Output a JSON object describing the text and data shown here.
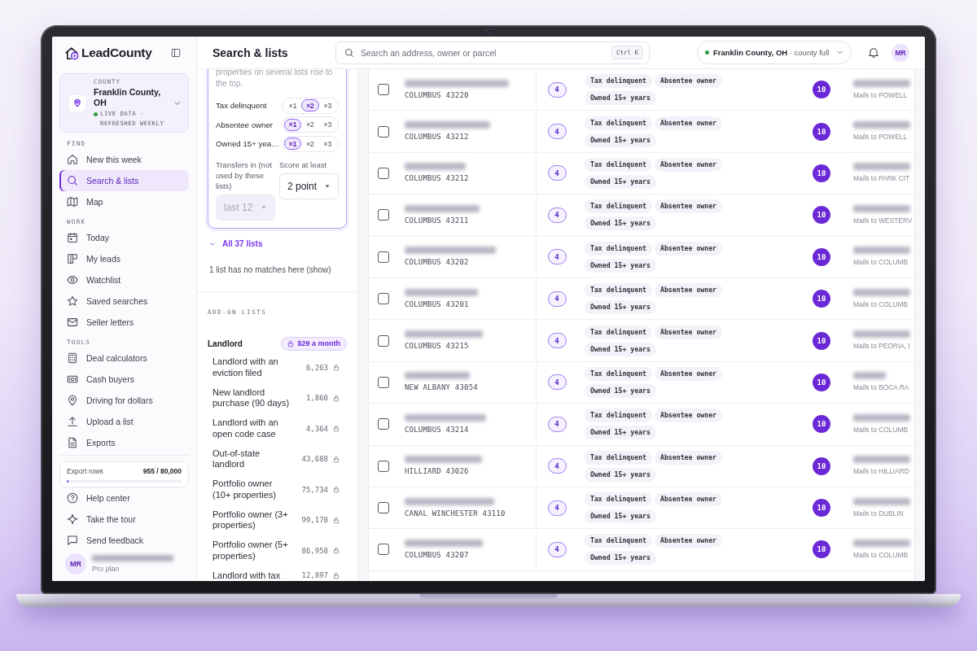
{
  "sidebar": {
    "brand": "LeadCounty",
    "county": {
      "label": "COUNTY",
      "name": "Franklin County, OH",
      "status": "LIVE DATA · REFRESHED WEEKLY"
    },
    "sections": [
      {
        "heading": "FIND",
        "items": [
          {
            "label": "New this week",
            "selected": false
          },
          {
            "label": "Search & lists",
            "selected": true
          },
          {
            "label": "Map",
            "selected": false
          }
        ]
      },
      {
        "heading": "WORK",
        "items": [
          {
            "label": "Today",
            "selected": false
          },
          {
            "label": "My leads",
            "selected": false
          },
          {
            "label": "Watchlist",
            "selected": false
          },
          {
            "label": "Saved searches",
            "selected": false
          },
          {
            "label": "Seller letters",
            "selected": false
          }
        ]
      },
      {
        "heading": "TOOLS",
        "items": [
          {
            "label": "Deal calculators",
            "selected": false
          },
          {
            "label": "Cash buyers",
            "selected": false
          },
          {
            "label": "Driving for dollars",
            "selected": false
          },
          {
            "label": "Upload a list",
            "selected": false
          },
          {
            "label": "Exports",
            "selected": false
          }
        ]
      }
    ],
    "export_meter": {
      "label": "Export rows",
      "reading": "955 / 80,000",
      "level": 0.012
    },
    "footer_links": [
      "Help center",
      "Take the tour",
      "Send feedback"
    ],
    "user": {
      "initials": "MR",
      "plan": "Pro plan"
    }
  },
  "topbar": {
    "title": "Search & lists",
    "search": {
      "placeholder": "Search an address, owner or parcel",
      "shortcut": "Ctrl K"
    },
    "county_pill": "**Franklin County, OH** · county full",
    "avatar": "MR"
  },
  "filters": {
    "description": "properties on several lists rise to the top.",
    "weights": [
      {
        "list": "Tax delinquent",
        "options": [
          {
            "label": "×1",
            "selected": false
          },
          {
            "label": "×2",
            "selected": true
          },
          {
            "label": "×3",
            "selected": false
          }
        ]
      },
      {
        "list": "Absentee owner",
        "options": [
          {
            "label": "×1",
            "selected": true
          },
          {
            "label": "×2",
            "selected": false
          },
          {
            "label": "×3",
            "selected": false
          }
        ]
      },
      {
        "list": "Owned 15+ yea…",
        "options": [
          {
            "label": "×1",
            "selected": true
          },
          {
            "label": "×2",
            "selected": false
          },
          {
            "label": "×3",
            "selected": false
          }
        ]
      }
    ],
    "transfers": {
      "label": "Transfers in (not used by these lists)",
      "value": "last 12",
      "disabled": true
    },
    "score": {
      "label": "Score at least",
      "value": "2 point"
    },
    "all_lists_link": "All 37 lists",
    "no_match_note": "1 list has no matches here (show)"
  },
  "add_on_lists": {
    "heading": "ADD-ON LISTS",
    "groups": [
      {
        "name": "Landlord",
        "price": "$29 a month",
        "items": [
          {
            "label": "Landlord with an eviction filed",
            "count": "6,263",
            "locked": true
          },
          {
            "label": "New landlord purchase (90 days)",
            "count": "1,860",
            "locked": true
          },
          {
            "label": "Landlord with an open code case",
            "count": "4,364",
            "locked": true
          },
          {
            "label": "Out-of-state landlord",
            "count": "43,688",
            "locked": true
          },
          {
            "label": "Portfolio owner (10+ properties)",
            "count": "75,734",
            "locked": true
          },
          {
            "label": "Portfolio owner (3+ properties)",
            "count": "99,170",
            "locked": true
          },
          {
            "label": "Portfolio owner (5+ properties)",
            "count": "86,958",
            "locked": true
          },
          {
            "label": "Landlord with tax",
            "count": "12,897",
            "locked": true
          }
        ]
      }
    ]
  },
  "table": {
    "rows": [
      {
        "checked": false,
        "city": "COLUMBUS 43220",
        "lists": "4",
        "tags": [
          "Tax delinquent",
          "Absentee owner",
          "Owned 15+ years"
        ],
        "score": "10",
        "mailing": "Mails to POWELL"
      },
      {
        "checked": false,
        "city": "COLUMBUS 43212",
        "lists": "4",
        "tags": [
          "Tax delinquent",
          "Absentee owner",
          "Owned 15+ years"
        ],
        "score": "10",
        "mailing": "Mails to POWELL"
      },
      {
        "checked": false,
        "city": "COLUMBUS 43212",
        "lists": "4",
        "tags": [
          "Tax delinquent",
          "Absentee owner",
          "Owned 15+ years"
        ],
        "score": "10",
        "mailing": "Mails to PARK CIT"
      },
      {
        "checked": false,
        "city": "COLUMBUS 43211",
        "lists": "4",
        "tags": [
          "Tax delinquent",
          "Absentee owner",
          "Owned 15+ years"
        ],
        "score": "10",
        "mailing": "Mails to WESTERV"
      },
      {
        "checked": false,
        "city": "COLUMBUS 43202",
        "lists": "4",
        "tags": [
          "Tax delinquent",
          "Absentee owner",
          "Owned 15+ years"
        ],
        "score": "10",
        "mailing": "Mails to COLUMB"
      },
      {
        "checked": false,
        "city": "COLUMBUS 43201",
        "lists": "4",
        "tags": [
          "Tax delinquent",
          "Absentee owner",
          "Owned 15+ years"
        ],
        "score": "10",
        "mailing": "Mails to COLUMB"
      },
      {
        "checked": false,
        "city": "COLUMBUS 43215",
        "lists": "4",
        "tags": [
          "Tax delinquent",
          "Absentee owner",
          "Owned 15+ years"
        ],
        "score": "10",
        "mailing": "Mails to PEORIA, I"
      },
      {
        "checked": false,
        "city": "NEW ALBANY 43054",
        "lists": "4",
        "tags": [
          "Tax delinquent",
          "Absentee owner",
          "Owned 15+ years"
        ],
        "score": "10",
        "mailing": "Mails to BOCA RA"
      },
      {
        "checked": false,
        "city": "COLUMBUS 43214",
        "lists": "4",
        "tags": [
          "Tax delinquent",
          "Absentee owner",
          "Owned 15+ years"
        ],
        "score": "10",
        "mailing": "Mails to COLUMB"
      },
      {
        "checked": false,
        "city": "HILLIARD 43026",
        "lists": "4",
        "tags": [
          "Tax delinquent",
          "Absentee owner",
          "Owned 15+ years"
        ],
        "score": "10",
        "mailing": "Mails to HILLIARD"
      },
      {
        "checked": false,
        "city": "CANAL WINCHESTER 43110",
        "lists": "4",
        "tags": [
          "Tax delinquent",
          "Absentee owner",
          "Owned 15+ years"
        ],
        "score": "10",
        "mailing": "Mails to DUBLIN"
      },
      {
        "checked": false,
        "city": "COLUMBUS 43207",
        "lists": "4",
        "tags": [
          "Tax delinquent",
          "Absentee owner",
          "Owned 15+ years"
        ],
        "score": "10",
        "mailing": "Mails to COLUMB"
      }
    ]
  }
}
